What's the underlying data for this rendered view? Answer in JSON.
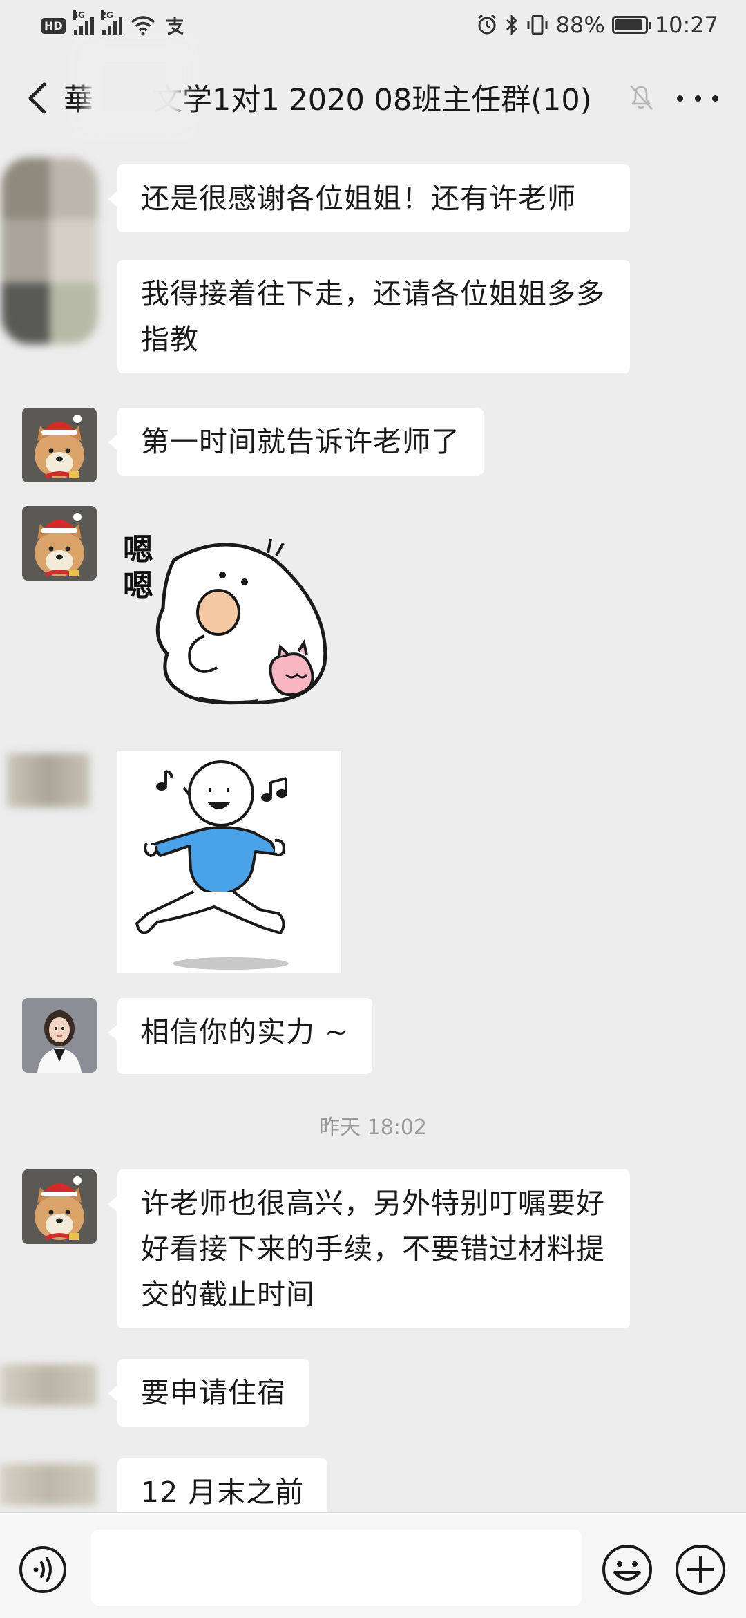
{
  "status_bar": {
    "hd_label": "HD",
    "network_1": "4G",
    "network_2": "2G",
    "battery_percent": "88%",
    "time": "10:27",
    "icons": [
      "hd-icon",
      "signal-icon",
      "wifi-icon",
      "alipay-icon",
      "alarm-icon",
      "bluetooth-icon",
      "vibrate-icon",
      "battery-icon"
    ]
  },
  "header": {
    "title": "華　　文学1对1 2020 08班主任群(10)",
    "back_icon": "chevron-left-icon",
    "mute_icon": "bell-off-icon",
    "more_icon": "more-dots-icon"
  },
  "messages": [
    {
      "type": "text",
      "text": "还是很感谢各位姐姐！还有许老师"
    },
    {
      "type": "text",
      "text": "我得接着往下走，还请各位姐姐多多指教"
    },
    {
      "type": "text",
      "text": "第一时间就告诉许老师了"
    },
    {
      "type": "sticker",
      "sticker_text": "嗯嗯",
      "sticker": "white-chick-sticker"
    },
    {
      "type": "sticker",
      "sticker": "running-stick-figure-sticker"
    },
    {
      "type": "text",
      "text": "相信你的实力 ~"
    },
    {
      "type": "timestamp",
      "text": "昨天 18:02"
    },
    {
      "type": "text",
      "text": "许老师也很高兴，另外特别叮嘱要好好看接下来的手续，不要错过材料提交的截止时间"
    },
    {
      "type": "text",
      "text": "要申请住宿"
    },
    {
      "type": "text",
      "text": "12 月末之前"
    }
  ],
  "input_bar": {
    "voice_icon": "voice-icon",
    "emoji_icon": "emoji-icon",
    "plus_icon": "plus-circle-icon",
    "value": ""
  },
  "colors": {
    "background": "#ededed",
    "bubble": "#ffffff",
    "sticker_blue": "#4aa2e8",
    "text": "#191919",
    "timestamp": "#9a9a9a"
  }
}
